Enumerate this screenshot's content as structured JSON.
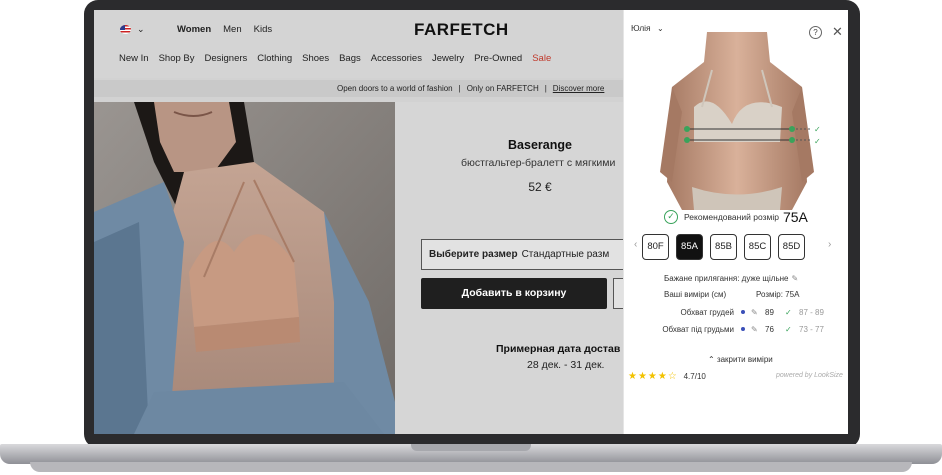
{
  "header": {
    "genders": [
      "Women",
      "Men",
      "Kids"
    ],
    "logo": "FARFETCH",
    "categories": [
      "New In",
      "Shop By",
      "Designers",
      "Clothing",
      "Shoes",
      "Bags",
      "Accessories",
      "Jewelry",
      "Pre-Owned",
      "Sale"
    ]
  },
  "promo": {
    "text1": "Open doors to a world of fashion",
    "separator": "|",
    "text2": "Only on FARFETCH",
    "link": "Discover more"
  },
  "product": {
    "brand": "Baserange",
    "name": "бюстгальтер-бралетт с мягкими",
    "price": "52 €",
    "size_label": "Выберите размер",
    "size_placeholder": "Стандартные разм",
    "add_to_cart": "Добавить в корзину",
    "delivery_label": "Примерная дата достав",
    "delivery_dates": "28 дек. - 31 дек."
  },
  "widget": {
    "profile_name": "Юлія",
    "help_symbol": "?",
    "recommended_label": "Рекомендований розмір",
    "recommended_size": "75A",
    "sizes": [
      {
        "label": "80F",
        "active": false
      },
      {
        "label": "85A",
        "active": true
      },
      {
        "label": "85B",
        "active": false
      },
      {
        "label": "85C",
        "active": false
      },
      {
        "label": "85D",
        "active": false
      }
    ],
    "fit_preference": "Бажане прилягання: дуже щільне",
    "your_measurements": "Ваші виміри (см)",
    "size_column": "Розмір: 75A",
    "measurements": [
      {
        "label": "Обхват грудей",
        "value": "89",
        "range": "87 - 89"
      },
      {
        "label": "Обхват під грудьми",
        "value": "76",
        "range": "73 - 77"
      }
    ],
    "collapse_label": "закрити виміри",
    "rating_stars": "★★★★☆",
    "rating_score": "4.7/10",
    "powered_by": "powered by LookSize"
  },
  "colors": {
    "accent_green": "#3aa35b",
    "sale_red": "#c0392b",
    "button_dark": "#1f1f1f",
    "star_yellow": "#f2c200"
  }
}
